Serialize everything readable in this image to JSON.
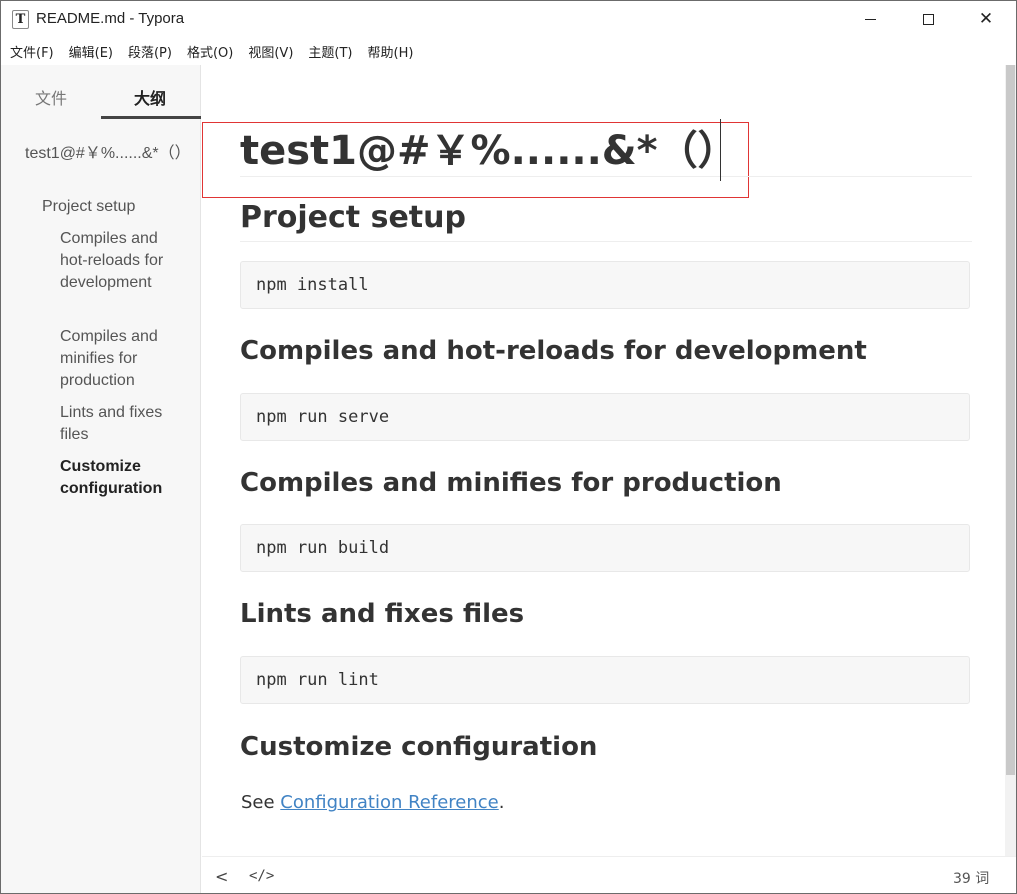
{
  "window": {
    "title": "README.md - Typora",
    "app_icon": "T",
    "minimize_icon": "minimize-icon",
    "maximize_icon": "maximize-icon",
    "close_icon": "close-icon",
    "close_glyph": "✕"
  },
  "menu": {
    "items": [
      "文件(F)",
      "编辑(E)",
      "段落(P)",
      "格式(O)",
      "视图(V)",
      "主题(T)",
      "帮助(H)"
    ]
  },
  "sidebar": {
    "tabs": {
      "files": "文件",
      "outline": "大纲"
    },
    "active_tab": "outline",
    "outline": [
      {
        "label": "test1@#￥%......&*（）",
        "level": 1
      },
      {
        "label": "Project setup",
        "level": 2
      },
      {
        "label": "Compiles and hot-reloads for development",
        "level": 3
      },
      {
        "label": "Compiles and minifies for production",
        "level": 3
      },
      {
        "label": "Lints and fixes files",
        "level": 3
      },
      {
        "label": "Customize configuration",
        "level": 3,
        "active": true
      }
    ]
  },
  "document": {
    "h1": "test1@#￥%......&*（）",
    "h2": "Project setup",
    "code1": "npm install",
    "h3a": "Compiles and hot-reloads for development",
    "code2": "npm run serve",
    "h3b": "Compiles and minifies for production",
    "code3": "npm run build",
    "h3c": "Lints and fixes files",
    "code4": "npm run lint",
    "h3d": "Customize configuration",
    "para_prefix": "See ",
    "link_text": "Configuration Reference",
    "para_suffix": "."
  },
  "statusbar": {
    "toggle_sidebar_glyph": "<",
    "source_mode_glyph": "</>",
    "word_count": "39 词"
  },
  "colors": {
    "highlight_box": "#e03535",
    "link": "#4183c4",
    "sidebar_bg": "#f7f7f7",
    "code_bg": "#f7f7f7"
  }
}
